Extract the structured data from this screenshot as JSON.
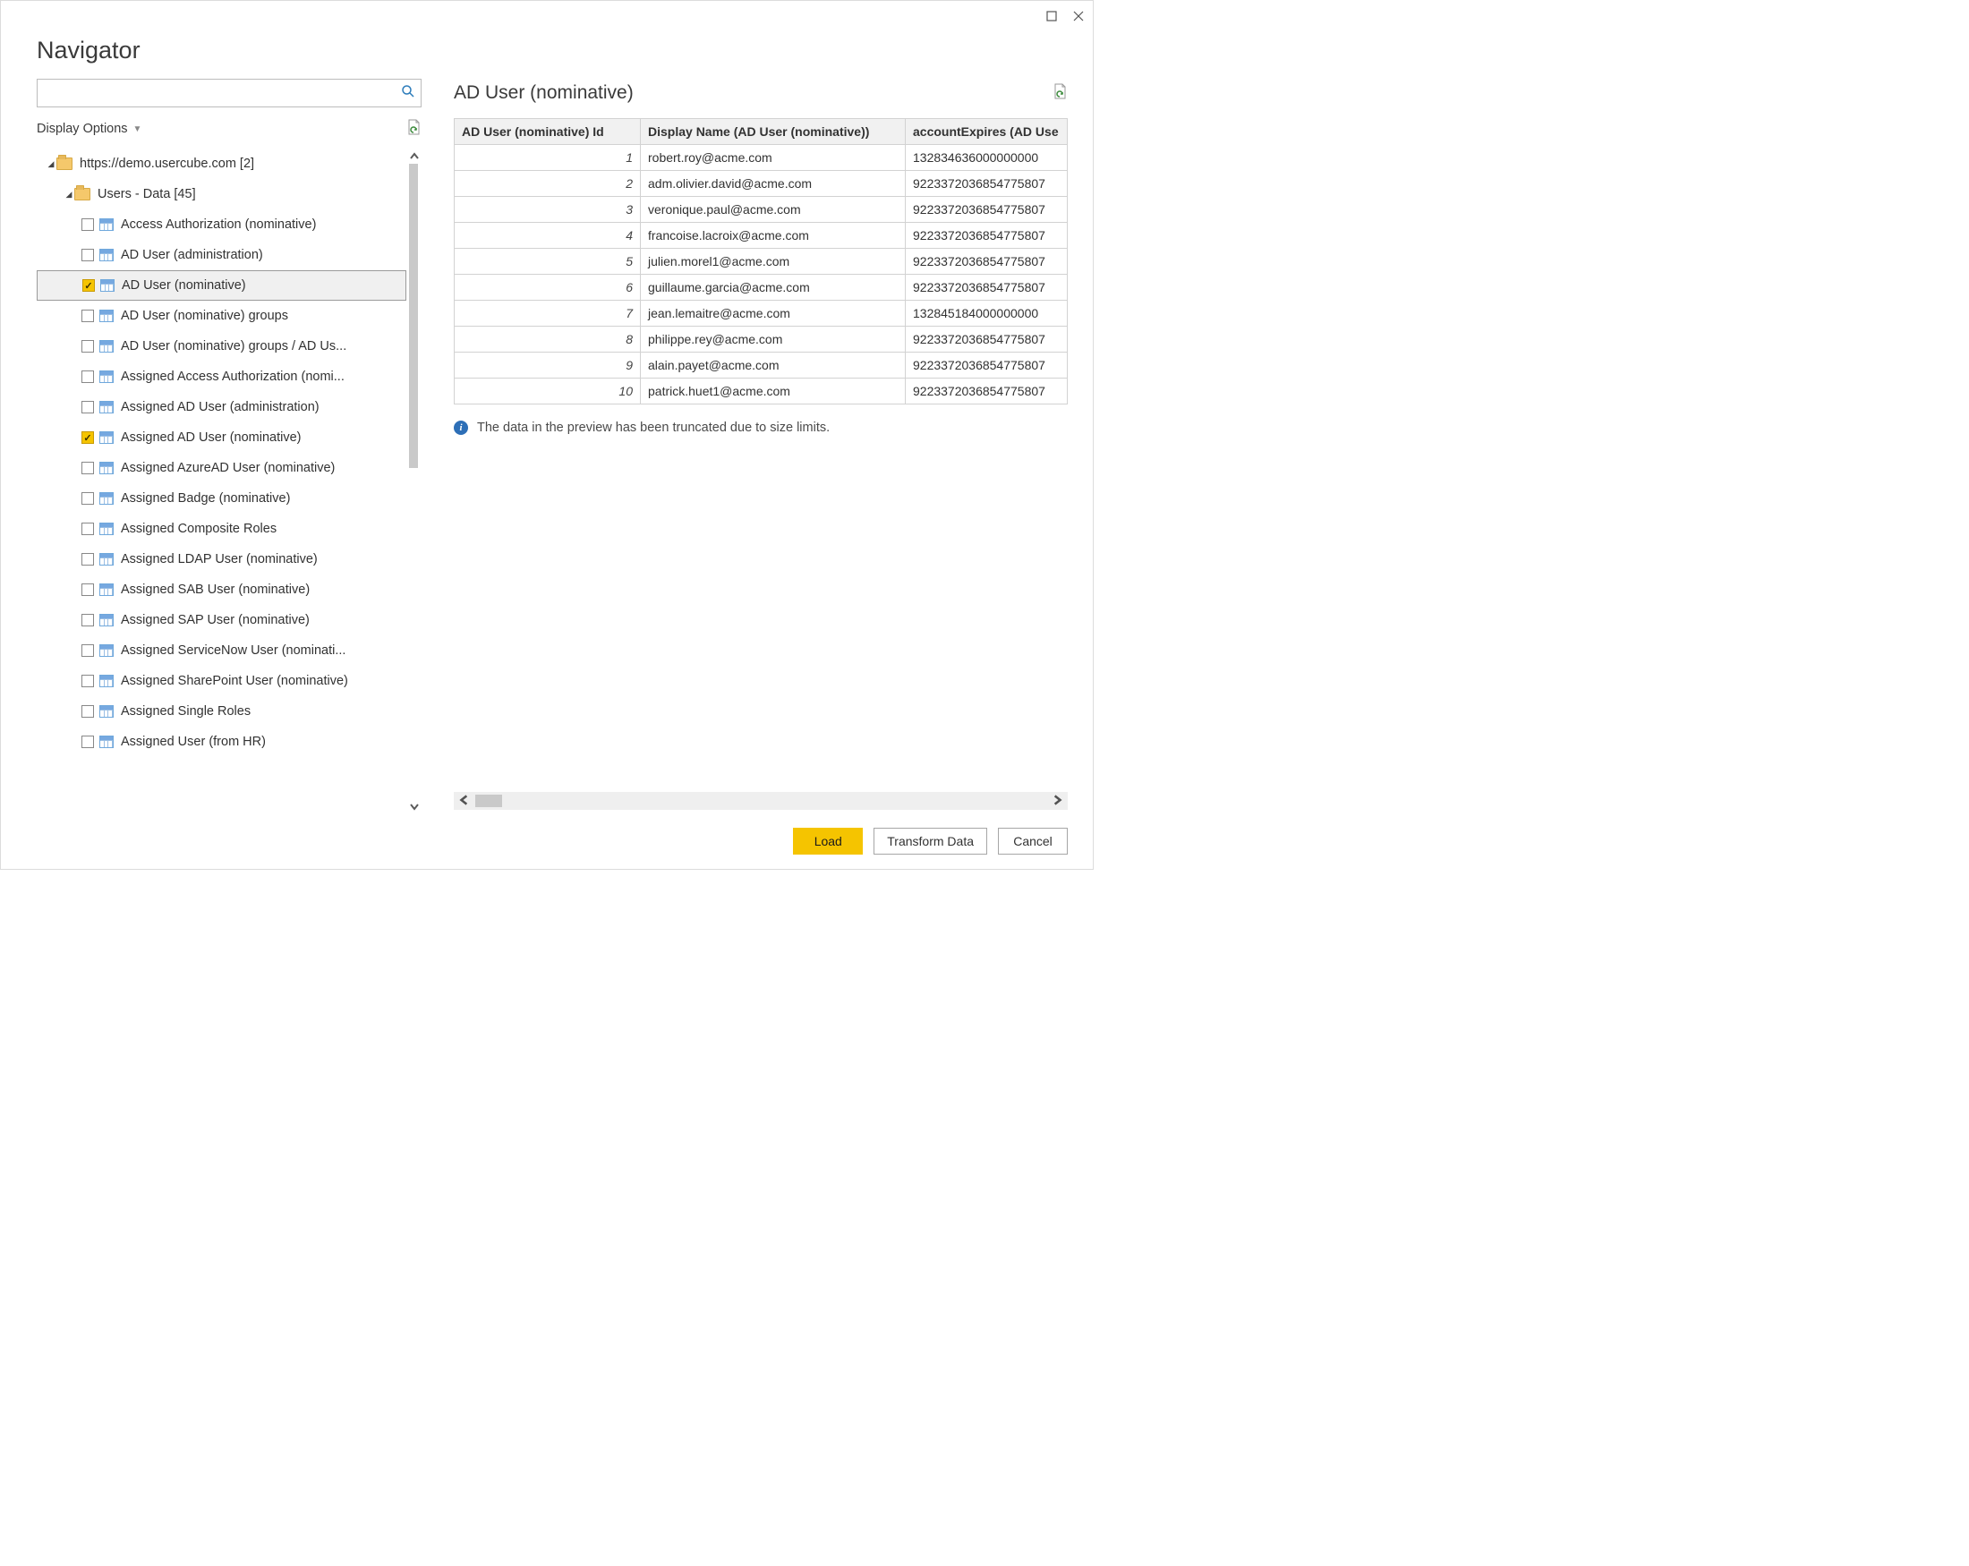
{
  "window": {
    "title": "Navigator"
  },
  "search": {
    "placeholder": ""
  },
  "displayOptions": {
    "label": "Display Options"
  },
  "tree": {
    "root": {
      "label": "https://demo.usercube.com [2]"
    },
    "group": {
      "label": "Users - Data [45]"
    },
    "items": [
      {
        "label": "Access Authorization (nominative)",
        "checked": false
      },
      {
        "label": "AD User (administration)",
        "checked": false
      },
      {
        "label": "AD User (nominative)",
        "checked": true,
        "selected": true
      },
      {
        "label": "AD User (nominative) groups",
        "checked": false
      },
      {
        "label": "AD User (nominative) groups / AD Us...",
        "checked": false
      },
      {
        "label": "Assigned Access Authorization (nomi...",
        "checked": false
      },
      {
        "label": "Assigned AD User (administration)",
        "checked": false
      },
      {
        "label": "Assigned AD User (nominative)",
        "checked": true
      },
      {
        "label": "Assigned AzureAD User (nominative)",
        "checked": false
      },
      {
        "label": "Assigned Badge (nominative)",
        "checked": false
      },
      {
        "label": "Assigned Composite Roles",
        "checked": false
      },
      {
        "label": "Assigned LDAP User (nominative)",
        "checked": false
      },
      {
        "label": "Assigned SAB User (nominative)",
        "checked": false
      },
      {
        "label": "Assigned SAP User (nominative)",
        "checked": false
      },
      {
        "label": "Assigned ServiceNow User (nominati...",
        "checked": false
      },
      {
        "label": "Assigned SharePoint User (nominative)",
        "checked": false
      },
      {
        "label": "Assigned Single Roles",
        "checked": false
      },
      {
        "label": "Assigned User (from HR)",
        "checked": false
      }
    ]
  },
  "preview": {
    "title": "AD User (nominative)",
    "columns": [
      "AD User (nominative) Id",
      "Display Name (AD User (nominative))",
      "accountExpires (AD Use"
    ],
    "rows": [
      {
        "id": "1",
        "display": "robert.roy@acme.com",
        "account": "132834636000000000"
      },
      {
        "id": "2",
        "display": "adm.olivier.david@acme.com",
        "account": "9223372036854775807"
      },
      {
        "id": "3",
        "display": "veronique.paul@acme.com",
        "account": "9223372036854775807"
      },
      {
        "id": "4",
        "display": "francoise.lacroix@acme.com",
        "account": "9223372036854775807"
      },
      {
        "id": "5",
        "display": "julien.morel1@acme.com",
        "account": "9223372036854775807"
      },
      {
        "id": "6",
        "display": "guillaume.garcia@acme.com",
        "account": "9223372036854775807"
      },
      {
        "id": "7",
        "display": "jean.lemaitre@acme.com",
        "account": "132845184000000000"
      },
      {
        "id": "8",
        "display": "philippe.rey@acme.com",
        "account": "9223372036854775807"
      },
      {
        "id": "9",
        "display": "alain.payet@acme.com",
        "account": "9223372036854775807"
      },
      {
        "id": "10",
        "display": "patrick.huet1@acme.com",
        "account": "9223372036854775807"
      }
    ],
    "info": "The data in the preview has been truncated due to size limits."
  },
  "footer": {
    "load": "Load",
    "transform": "Transform Data",
    "cancel": "Cancel"
  }
}
